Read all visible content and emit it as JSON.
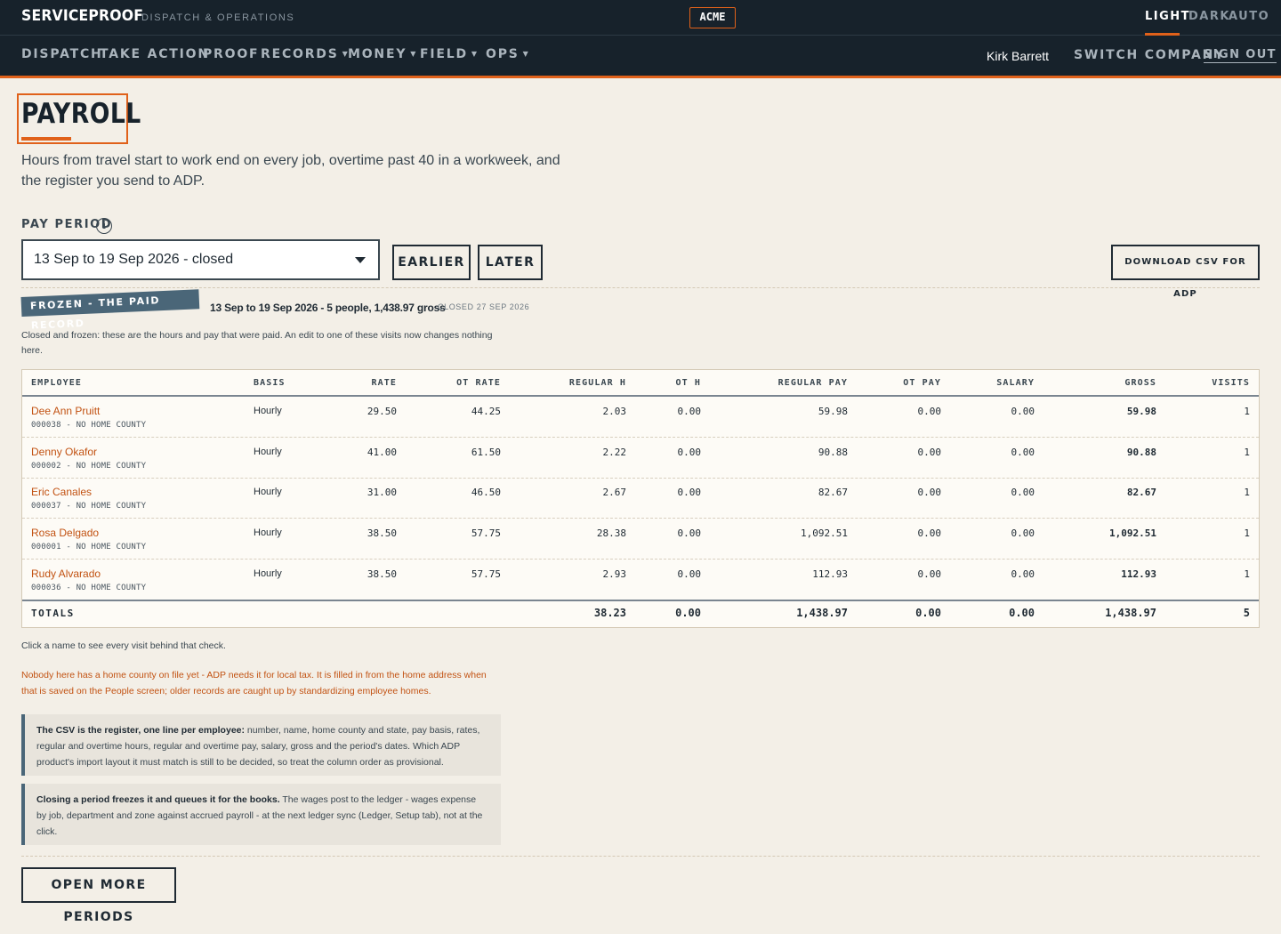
{
  "app": {
    "brand": "SERVICEPROOF",
    "brand_sub": "DISPATCH & OPERATIONS",
    "company_badge": "ACME",
    "theme": {
      "light": "LIGHT",
      "dark": "DARK",
      "auto": "AUTO",
      "active": "light"
    },
    "accent_color": "#e0611a",
    "nav_bg": "#17222b"
  },
  "nav": {
    "items": [
      {
        "label": "DISPATCH"
      },
      {
        "label": "TAKE ACTION"
      },
      {
        "label": "PROOF"
      },
      {
        "label": "RECORDS",
        "dropdown": true
      },
      {
        "label": "MONEY",
        "dropdown": true
      },
      {
        "label": "FIELD",
        "dropdown": true
      },
      {
        "label": "OPS",
        "dropdown": true
      }
    ],
    "user": "Kirk Barrett",
    "switch_company": "SWITCH COMPANY",
    "sign_out": "SIGN OUT"
  },
  "page": {
    "title": "PAYROLL",
    "description": "Hours from travel start to work end on every job, overtime past 40 in a workweek, and the register you send to ADP."
  },
  "period": {
    "label": "PAY PERIOD",
    "info_icon": "info-icon",
    "selected": "13 Sep to 19 Sep 2026 - closed",
    "earlier": "EARLIER",
    "later": "LATER",
    "download": "DOWNLOAD CSV FOR ADP"
  },
  "frozen": {
    "badge": "FROZEN - THE PAID RECORD",
    "summary": "13 Sep to 19 Sep 2026 - 5 people, 1,438.97 gross",
    "closed": "CLOSED 27 SEP 2026",
    "note": "Closed and frozen: these are the hours and pay that were paid. An edit to one of these visits now changes nothing here."
  },
  "table": {
    "headers": {
      "employee": "EMPLOYEE",
      "basis": "BASIS",
      "rate": "RATE",
      "ot_rate": "OT RATE",
      "regular_h": "REGULAR H",
      "ot_h": "OT H",
      "regular_pay": "REGULAR PAY",
      "ot_pay": "OT PAY",
      "salary": "SALARY",
      "gross": "GROSS",
      "visits": "VISITS"
    },
    "rows": [
      {
        "name": "Dee Ann Pruitt",
        "sub": "000038 - NO HOME COUNTY",
        "basis": "Hourly",
        "rate": "29.50",
        "ot_rate": "44.25",
        "regular_h": "2.03",
        "ot_h": "0.00",
        "regular_pay": "59.98",
        "ot_pay": "0.00",
        "salary": "0.00",
        "gross": "59.98",
        "visits": "1"
      },
      {
        "name": "Denny Okafor",
        "sub": "000002 - NO HOME COUNTY",
        "basis": "Hourly",
        "rate": "41.00",
        "ot_rate": "61.50",
        "regular_h": "2.22",
        "ot_h": "0.00",
        "regular_pay": "90.88",
        "ot_pay": "0.00",
        "salary": "0.00",
        "gross": "90.88",
        "visits": "1"
      },
      {
        "name": "Eric Canales",
        "sub": "000037 - NO HOME COUNTY",
        "basis": "Hourly",
        "rate": "31.00",
        "ot_rate": "46.50",
        "regular_h": "2.67",
        "ot_h": "0.00",
        "regular_pay": "82.67",
        "ot_pay": "0.00",
        "salary": "0.00",
        "gross": "82.67",
        "visits": "1"
      },
      {
        "name": "Rosa Delgado",
        "sub": "000001 - NO HOME COUNTY",
        "basis": "Hourly",
        "rate": "38.50",
        "ot_rate": "57.75",
        "regular_h": "28.38",
        "ot_h": "0.00",
        "regular_pay": "1,092.51",
        "ot_pay": "0.00",
        "salary": "0.00",
        "gross": "1,092.51",
        "visits": "1"
      },
      {
        "name": "Rudy Alvarado",
        "sub": "000036 - NO HOME COUNTY",
        "basis": "Hourly",
        "rate": "38.50",
        "ot_rate": "57.75",
        "regular_h": "2.93",
        "ot_h": "0.00",
        "regular_pay": "112.93",
        "ot_pay": "0.00",
        "salary": "0.00",
        "gross": "112.93",
        "visits": "1"
      }
    ],
    "totals": {
      "label": "TOTALS",
      "regular_h": "38.23",
      "ot_h": "0.00",
      "regular_pay": "1,438.97",
      "ot_pay": "0.00",
      "salary": "0.00",
      "gross": "1,438.97",
      "visits": "5"
    }
  },
  "hint": "Click a name to see every visit behind that check.",
  "warning": "Nobody here has a home county on file yet - ADP needs it for local tax. It is filled in from the home address when that is saved on the People screen; older records are caught up by standardizing employee homes.",
  "notes": [
    {
      "bold": "The CSV is the register, one line per employee:",
      "text": " number, name, home county and state, pay basis, rates, regular and overtime hours, regular and overtime pay, salary, gross and the period's dates. Which ADP product's import layout it must match is still to be decided, so treat the column order as provisional."
    },
    {
      "bold": "Closing a period freezes it and queues it for the books.",
      "text": " The wages post to the ledger - wages expense by job, department and zone against accrued payroll - at the next ledger sync (Ledger, Setup tab), not at the click."
    }
  ],
  "open_more": "OPEN MORE PERIODS"
}
